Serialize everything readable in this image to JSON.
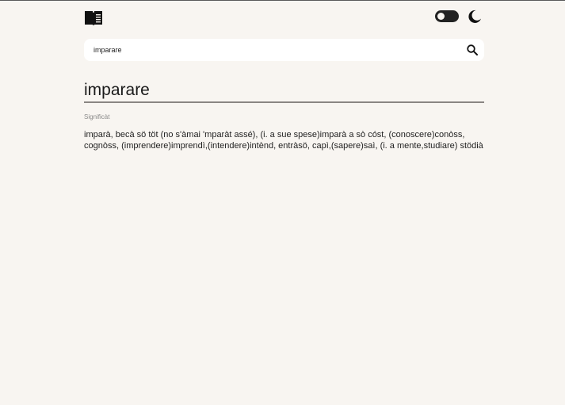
{
  "header": {
    "logo_icon": "book-open-icon",
    "theme_toggle_icon": "toggle-icon",
    "dark_mode_icon": "moon-icon"
  },
  "search": {
    "value": "imparare",
    "icon": "search-icon"
  },
  "entry": {
    "word": "imparare",
    "section_label": "Significàt",
    "meaning": "imparà, becà sö töt (no s'àmai 'mparàt assé), (i. a sue spese)imparà a sò cóst, (conoscere)conòss, cognòss, (imprendere)imprendì,(intendere)intènd, entràsö, capì,(sapere)saì, (i. a mente,studiare) stödià"
  },
  "colors": {
    "background": "#f8f5f1",
    "text": "#1f1f1f",
    "muted": "#8a8a8a",
    "rule": "#8a8683",
    "icon": "#111111"
  }
}
